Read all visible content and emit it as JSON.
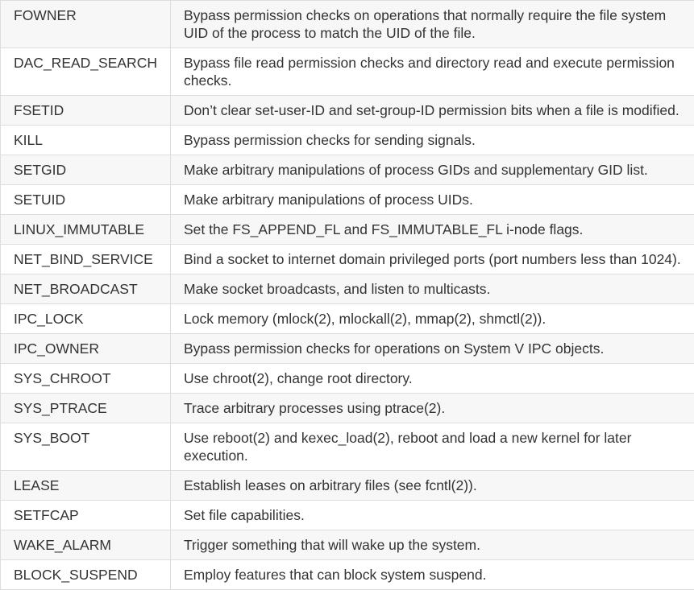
{
  "capabilities": [
    {
      "name": "FOWNER",
      "description": "Bypass permission checks on operations that normally require the file system UID of the process to match the UID of the file."
    },
    {
      "name": "DAC_READ_SEARCH",
      "description": "Bypass file read permission checks and directory read and execute permission checks."
    },
    {
      "name": "FSETID",
      "description": "Don’t clear set-user-ID and set-group-ID permission bits when a file is modified."
    },
    {
      "name": "KILL",
      "description": "Bypass permission checks for sending signals."
    },
    {
      "name": "SETGID",
      "description": "Make arbitrary manipulations of process GIDs and supplementary GID list."
    },
    {
      "name": "SETUID",
      "description": "Make arbitrary manipulations of process UIDs."
    },
    {
      "name": "LINUX_IMMUTABLE",
      "description": "Set the FS_APPEND_FL and FS_IMMUTABLE_FL i-node flags."
    },
    {
      "name": "NET_BIND_SERVICE",
      "description": "Bind a socket to internet domain privileged ports (port numbers less than 1024)."
    },
    {
      "name": "NET_BROADCAST",
      "description": "Make socket broadcasts, and listen to multicasts."
    },
    {
      "name": "IPC_LOCK",
      "description": "Lock memory (mlock(2), mlockall(2), mmap(2), shmctl(2))."
    },
    {
      "name": "IPC_OWNER",
      "description": "Bypass permission checks for operations on System V IPC objects."
    },
    {
      "name": "SYS_CHROOT",
      "description": "Use chroot(2), change root directory."
    },
    {
      "name": "SYS_PTRACE",
      "description": "Trace arbitrary processes using ptrace(2)."
    },
    {
      "name": "SYS_BOOT",
      "description": "Use reboot(2) and kexec_load(2), reboot and load a new kernel for later execution."
    },
    {
      "name": "LEASE",
      "description": "Establish leases on arbitrary files (see fcntl(2))."
    },
    {
      "name": "SETFCAP",
      "description": "Set file capabilities."
    },
    {
      "name": "WAKE_ALARM",
      "description": "Trigger something that will wake up the system."
    },
    {
      "name": "BLOCK_SUSPEND",
      "description": "Employ features that can block system suspend."
    }
  ]
}
